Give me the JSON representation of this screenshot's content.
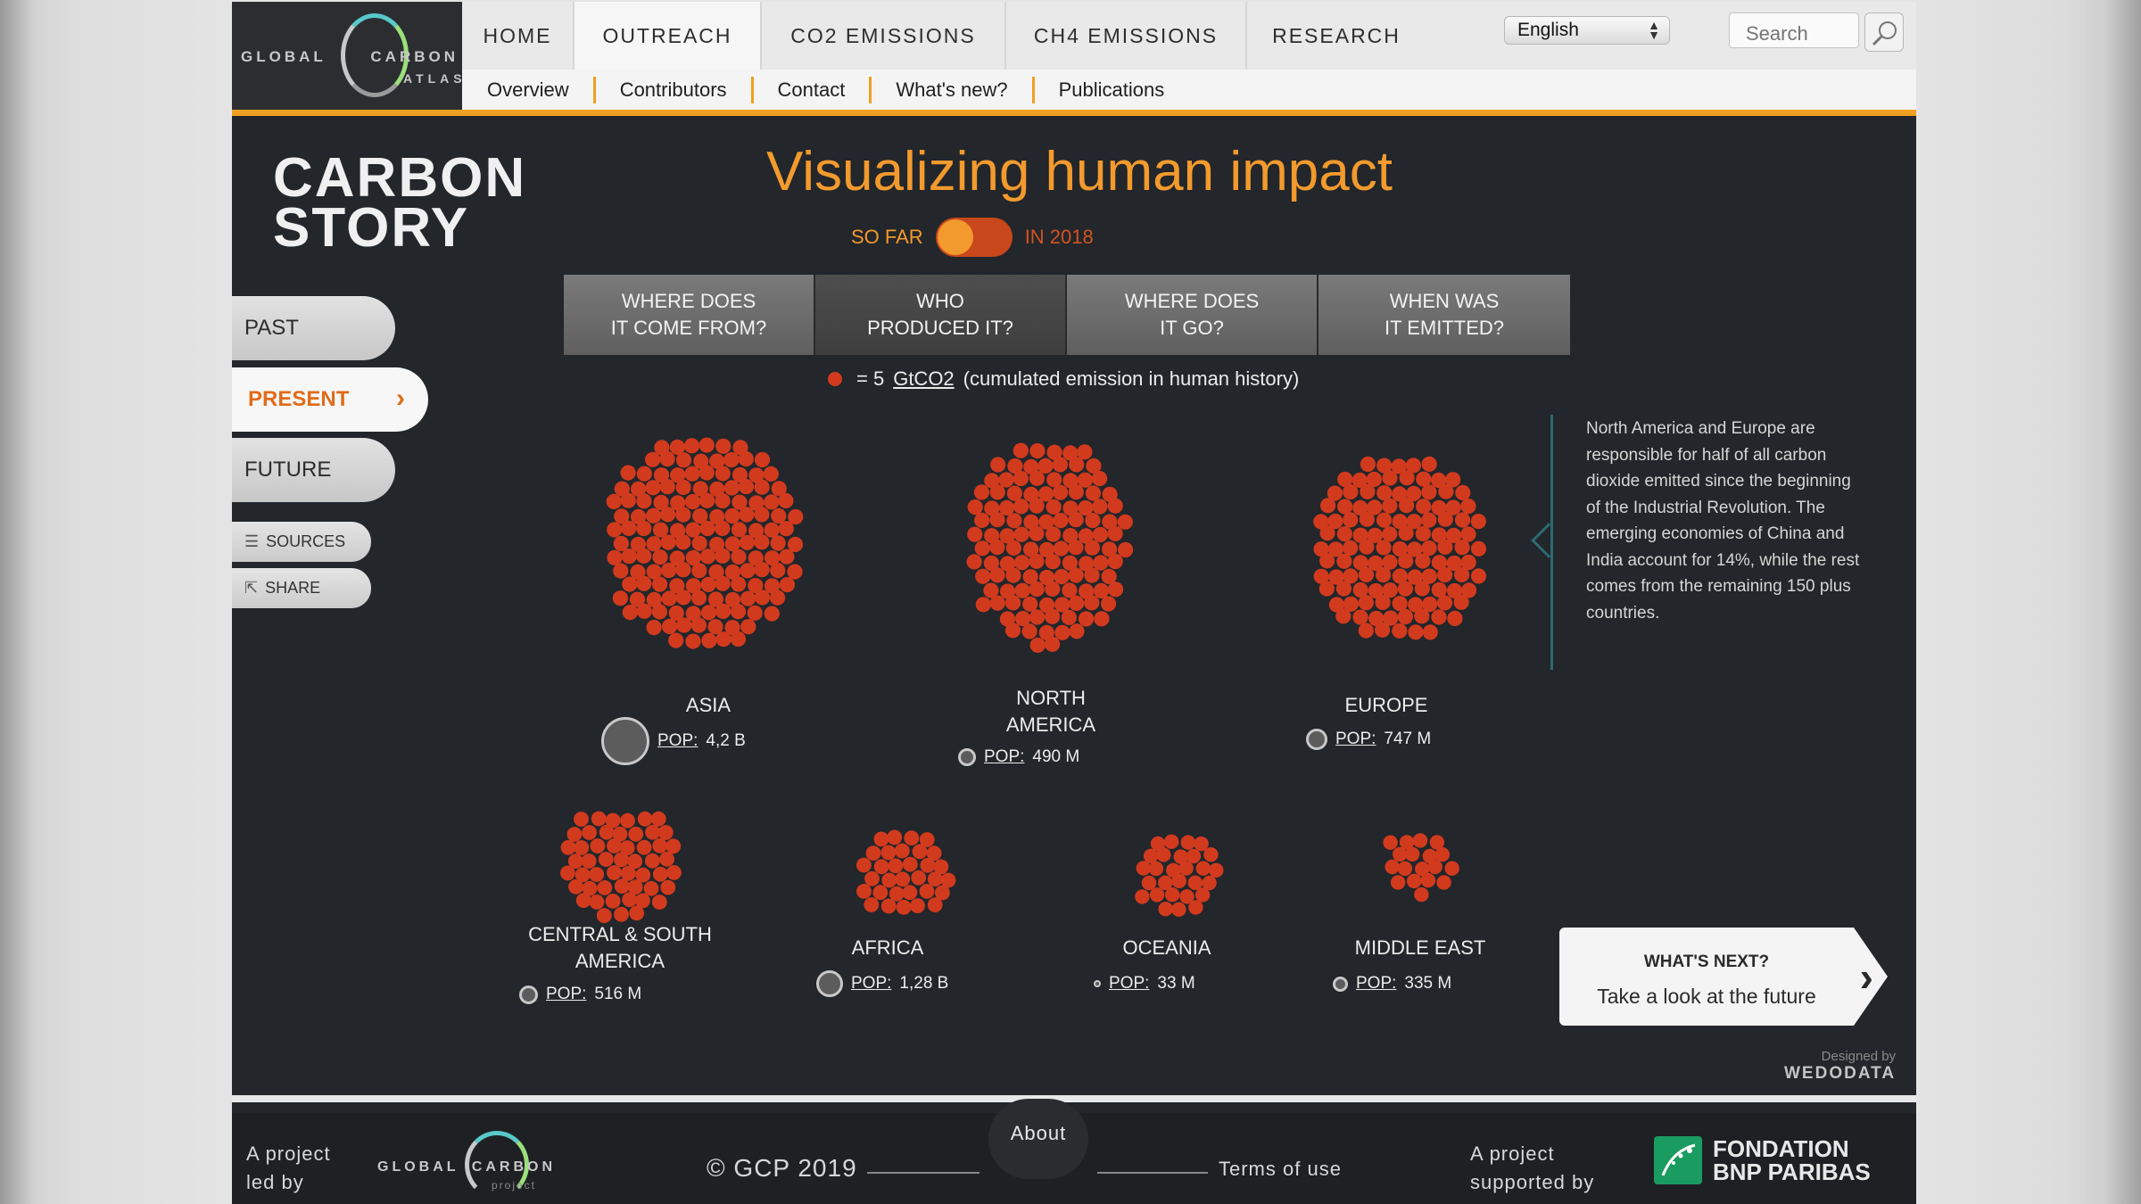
{
  "header": {
    "logo": {
      "word1": "GLOBAL",
      "word2": "CARBON",
      "word3": "ATLAS"
    },
    "nav": [
      {
        "label": "HOME"
      },
      {
        "label": "OUTREACH",
        "active": true
      },
      {
        "label": "CO2 EMISSIONS"
      },
      {
        "label": "CH4 EMISSIONS"
      },
      {
        "label": "RESEARCH"
      }
    ],
    "subnav": [
      "Overview",
      "Contributors",
      "Contact",
      "What's new?",
      "Publications"
    ],
    "language": "English",
    "search_placeholder": "Search"
  },
  "sidebar": {
    "brand_line1": "CARBON",
    "brand_line2": "STORY",
    "items": [
      {
        "label": "PAST"
      },
      {
        "label": "PRESENT",
        "active": true
      },
      {
        "label": "FUTURE"
      }
    ],
    "sources_label": "SOURCES",
    "share_label": "SHARE"
  },
  "main": {
    "title": "Visualizing human impact",
    "toggle": {
      "left": "SO FAR",
      "right": "IN 2018",
      "state": "so-far"
    },
    "tabs": [
      {
        "label": "WHERE DOES\nIT COME FROM?"
      },
      {
        "label": "WHO\nPRODUCED IT?",
        "active": true
      },
      {
        "label": "WHERE DOES\nIT GO?"
      },
      {
        "label": "WHEN WAS\nIT EMITTED?"
      }
    ],
    "legend": {
      "prefix": "= 5",
      "unit": "GtCO2",
      "suffix": "(cumulated emission in human history)"
    },
    "regions": [
      {
        "name": "ASIA",
        "pop_label": "POP:",
        "pop_value": "4,2 B"
      },
      {
        "name": "NORTH\nAMERICA",
        "pop_label": "POP:",
        "pop_value": "490 M"
      },
      {
        "name": "EUROPE",
        "pop_label": "POP:",
        "pop_value": "747 M"
      },
      {
        "name": "CENTRAL & SOUTH\nAMERICA",
        "pop_label": "POP:",
        "pop_value": "516 M"
      },
      {
        "name": "AFRICA",
        "pop_label": "POP:",
        "pop_value": "1,28 B"
      },
      {
        "name": "OCEANIA",
        "pop_label": "POP:",
        "pop_value": "33 M"
      },
      {
        "name": "MIDDLE EAST",
        "pop_label": "POP:",
        "pop_value": "335 M"
      }
    ],
    "info": "North America and Europe are responsible for half of all carbon dioxide emitted since the beginning of the Industrial Revolution. The emerging economies of China and India account for 14%, while the rest comes from the remaining 150 plus countries.",
    "next": {
      "title": "WHAT'S NEXT?",
      "subtitle": "Take a look at the future"
    },
    "designed_by": {
      "label": "Designed by",
      "name": "WEDODATA"
    }
  },
  "footer": {
    "led_by": "A project\nled by",
    "logo_word1": "GLOBAL",
    "logo_word2": "CARBON",
    "logo_sub": "project",
    "copyright": "© GCP 2019",
    "about": "About",
    "terms": "Terms of use",
    "supported_by": "A project\nsupported by",
    "sponsor_line1": "FONDATION",
    "sponsor_line2": "BNP PARIBAS"
  },
  "colors": {
    "accent": "#f29a2e",
    "dot": "#d23a1e",
    "panel_bg": "#23262a"
  }
}
